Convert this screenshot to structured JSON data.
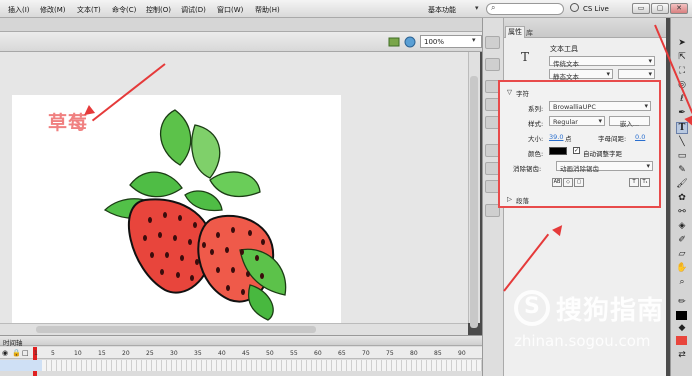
{
  "menu": {
    "items": [
      "插入(I)",
      "修改(M)",
      "文本(T)",
      "命令(C)",
      "控制(O)",
      "调试(D)",
      "窗口(W)",
      "帮助(H)"
    ],
    "workspace_label": "基本功能",
    "workspace_arrow": "▾",
    "search_icon": "⌕",
    "cslive_label": "CS Live",
    "min_label": "▭",
    "max_label": "▢",
    "close_label": "✕"
  },
  "editbar": {
    "zoom_value": "100%",
    "zoom_arrow": "▾"
  },
  "stage": {
    "title_text": "草莓"
  },
  "timeline": {
    "tab_label": "时间轴",
    "frame_numbers": [
      "1",
      "5",
      "10",
      "15",
      "20",
      "25",
      "30",
      "35",
      "40",
      "45",
      "50",
      "55",
      "60",
      "65",
      "70",
      "75",
      "80",
      "85",
      "90"
    ]
  },
  "properties": {
    "tab_props": "属性",
    "tab_lib": "库",
    "tool_icon": "T",
    "tool_type": "文本工具",
    "text_type": "传统文本",
    "text_sub_type": "静态文本",
    "section_char": "字符",
    "family_label": "系列:",
    "family_value": "BrowalliaUPC",
    "style_label": "样式:",
    "style_value": "Regular",
    "embed_label": "嵌入...",
    "size_label": "大小:",
    "size_value": "39.0",
    "size_unit": "点",
    "spacing_label": "字母间距:",
    "spacing_value": "0.0",
    "color_label": "颜色:",
    "autokern_label": "自动调整字距",
    "antialias_label": "消除锯齿:",
    "antialias_value": "动画消除锯齿",
    "section_para": "段落",
    "collapse_arrow": "▽",
    "expand_arrow": "▷",
    "dd_arrow": "▾",
    "check_mark": "✓",
    "btn_ab": "AB",
    "btn_sel": "◇",
    "btn_border": "▢",
    "btn_sup": "T",
    "btn_sub": "T₁"
  },
  "watermark": {
    "logo_letter": "S",
    "text": "搜狗指南",
    "url": "zhinan.sogou.com"
  },
  "colors": {
    "stage_bg": "#ffffff",
    "highlight_red": "#e84b4b",
    "strawberry": "#e8453c",
    "leaf": "#3cb54a"
  }
}
